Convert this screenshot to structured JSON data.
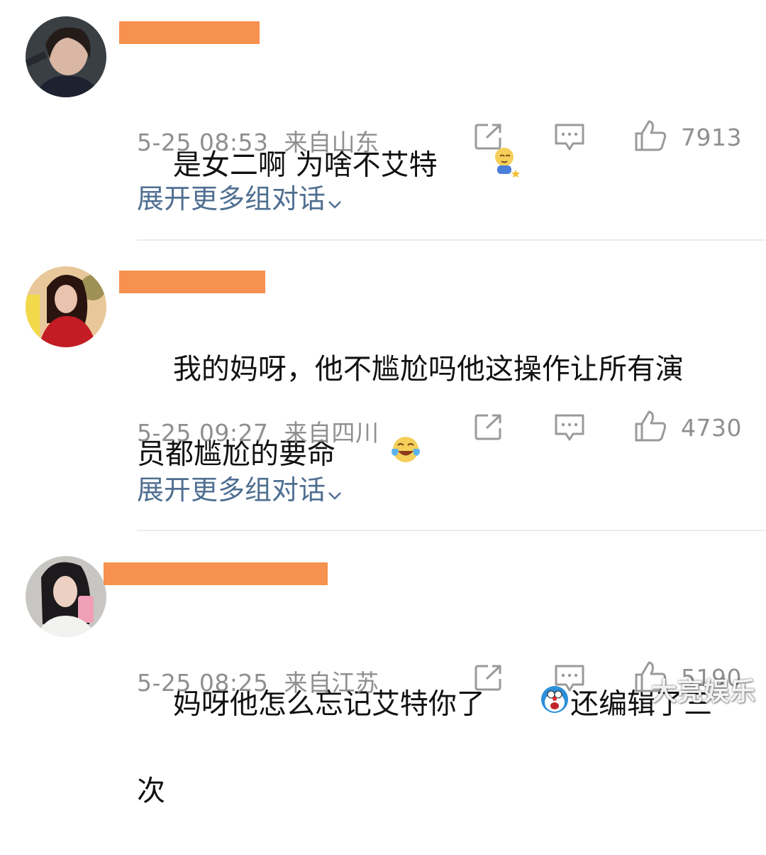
{
  "comments": [
    {
      "text": "是女二啊 为啥不艾特",
      "emoji": "shy-emoji",
      "time": "5-25 08:53",
      "location": "来自山东",
      "likes": "7913",
      "expand": "展开更多组对话"
    },
    {
      "text": "我的妈呀，他不尴尬吗他这操作让所有演\n员都尴尬的要命",
      "emoji": "laugh-cry-emoji",
      "time": "5-25 09:27",
      "location": "来自四川",
      "likes": "4730",
      "expand": "展开更多组对话"
    },
    {
      "text_part1": "妈呀他怎么忘记艾特你了",
      "emoji": "doraemon-emoji",
      "text_part2": "还编辑了三次",
      "time": "5-25 08:25",
      "location": "来自江苏",
      "likes": "5190"
    }
  ],
  "watermark": "大亮娱乐",
  "colors": {
    "redaction": "#f6914f",
    "link": "#4f6f91",
    "meta": "#8f8f8f"
  }
}
